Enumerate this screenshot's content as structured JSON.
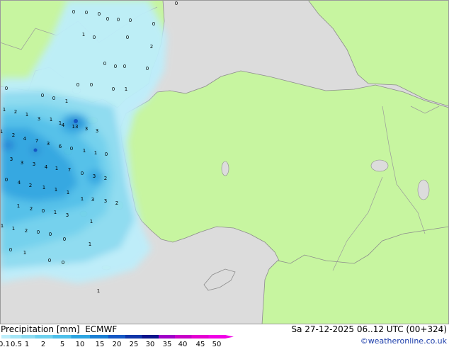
{
  "header": {
    "parameter": "Precipitation [mm]",
    "model": "ECMWF",
    "valid_time": "Sa 27-12-2025 06..12 UTC (00+324)",
    "credit": "©weatheronline.co.uk"
  },
  "legend": {
    "labels": [
      "0.1",
      "0.5",
      "1",
      "2",
      "5",
      "10",
      "15",
      "20",
      "25",
      "30",
      "35",
      "40",
      "45",
      "50"
    ],
    "colors": [
      "#bdeefb",
      "#a4e6f7",
      "#8cdcf2",
      "#6fd1ee",
      "#4fc0ea",
      "#2ea6e2",
      "#1a7fd4",
      "#1558c4",
      "#1035a8",
      "#0b148c",
      "#a000c8",
      "#c800c8",
      "#e400d2",
      "#f000e6"
    ]
  },
  "colors": {
    "sea": "#dcdcdc",
    "land": "#c7f5a0",
    "border": "#9a9a9a",
    "coast": "#8c8c8c"
  },
  "map_values": [
    "0",
    "0",
    "0",
    "0",
    "0",
    "0",
    "0",
    "0",
    "1",
    "0",
    "0",
    "2",
    "0",
    "0",
    "0",
    "0",
    "0",
    "0",
    "0",
    "0",
    "1",
    "0",
    "1",
    "0",
    "1",
    "2",
    "1",
    "3",
    "1",
    "1",
    "4",
    "13",
    "3",
    "3",
    "1",
    "2",
    "4",
    "7",
    "3",
    "6",
    "0",
    "1",
    "1",
    "0",
    "3",
    "3",
    "3",
    "4",
    "1",
    "7",
    "0",
    "3",
    "2",
    "0",
    "4",
    "2",
    "1",
    "1",
    "1",
    "1",
    "3",
    "3",
    "2",
    "1",
    "2",
    "0",
    "1",
    "3",
    "1",
    "1",
    "1",
    "2",
    "0",
    "0",
    "0",
    "1",
    "0",
    "1",
    "0",
    "0",
    "1"
  ]
}
